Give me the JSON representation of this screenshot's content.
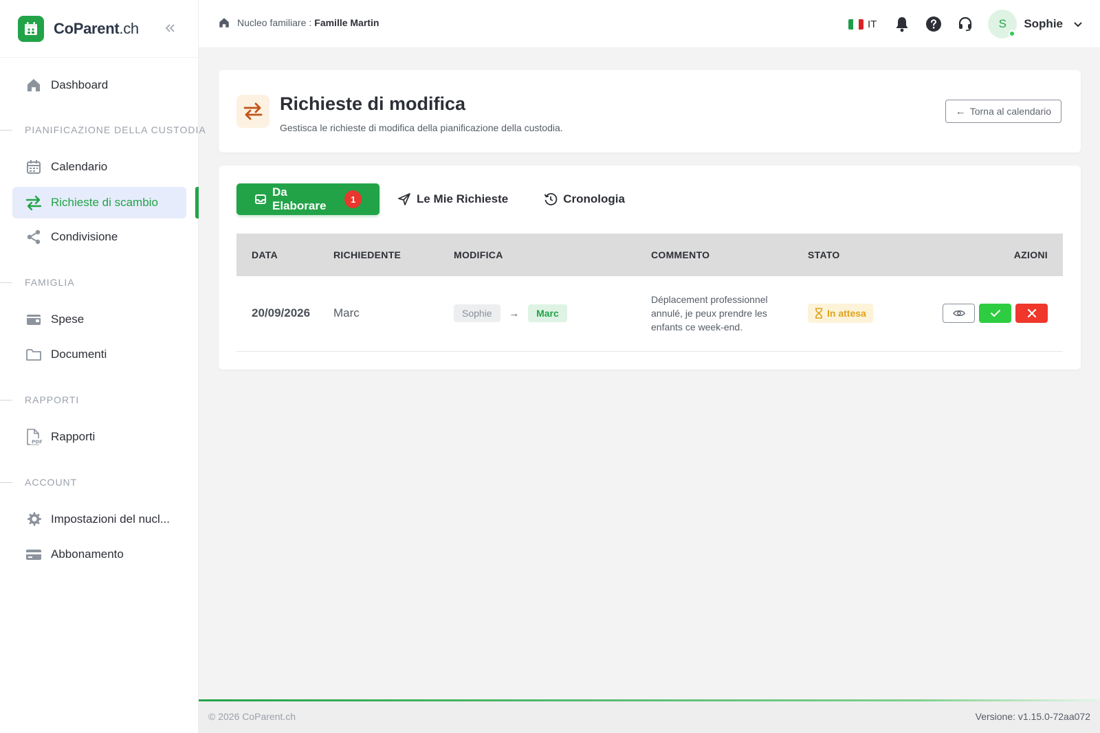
{
  "brand": {
    "name": "CoParent",
    "tld": ".ch"
  },
  "sidebar": {
    "dashboard": "Dashboard",
    "sections": [
      {
        "title": "PIANIFICAZIONE DELLA CUSTODIA",
        "items": [
          "Calendario",
          "Richieste di scambio",
          "Condivisione"
        ]
      },
      {
        "title": "FAMIGLIA",
        "items": [
          "Spese",
          "Documenti"
        ]
      },
      {
        "title": "RAPPORTI",
        "items": [
          "Rapporti"
        ]
      },
      {
        "title": "ACCOUNT",
        "items": [
          "Impostazioni del nucl...",
          "Abbonamento"
        ]
      }
    ],
    "active_item": "Richieste di scambio",
    "pdf_label": "PDF"
  },
  "topbar": {
    "crumb_label": "Nucleo familiare",
    "crumb_sep": ":",
    "crumb_value": "Famille Martin",
    "lang": "IT",
    "user_initial": "S",
    "user_name": "Sophie"
  },
  "header": {
    "title": "Richieste di modifica",
    "subtitle": "Gestisca le richieste di modifica della pianificazione della custodia.",
    "back_label": "Torna al calendario"
  },
  "tabs": [
    {
      "label": "Da Elaborare",
      "badge": "1"
    },
    {
      "label": "Le Mie Richieste"
    },
    {
      "label": "Cronologia"
    }
  ],
  "table": {
    "columns": [
      "DATA",
      "RICHIEDENTE",
      "MODIFICA",
      "COMMENTO",
      "STATO",
      "AZIONI"
    ],
    "rows": [
      {
        "date": "20/09/2026",
        "requester": "Marc",
        "from": "Sophie",
        "to": "Marc",
        "comment": "Déplacement professionnel annulé, je peux prendre les enfants ce week-end.",
        "status": "In attesa"
      }
    ]
  },
  "footer": {
    "copyright": "© 2026 CoParent.ch",
    "version": "Versione: v1.15.0-72aa072"
  },
  "colors": {
    "accent": "#22a348",
    "badge": "#e8372c",
    "pending": "#e0a31a",
    "reject": "#f0372c",
    "approve": "#2ecc40"
  }
}
